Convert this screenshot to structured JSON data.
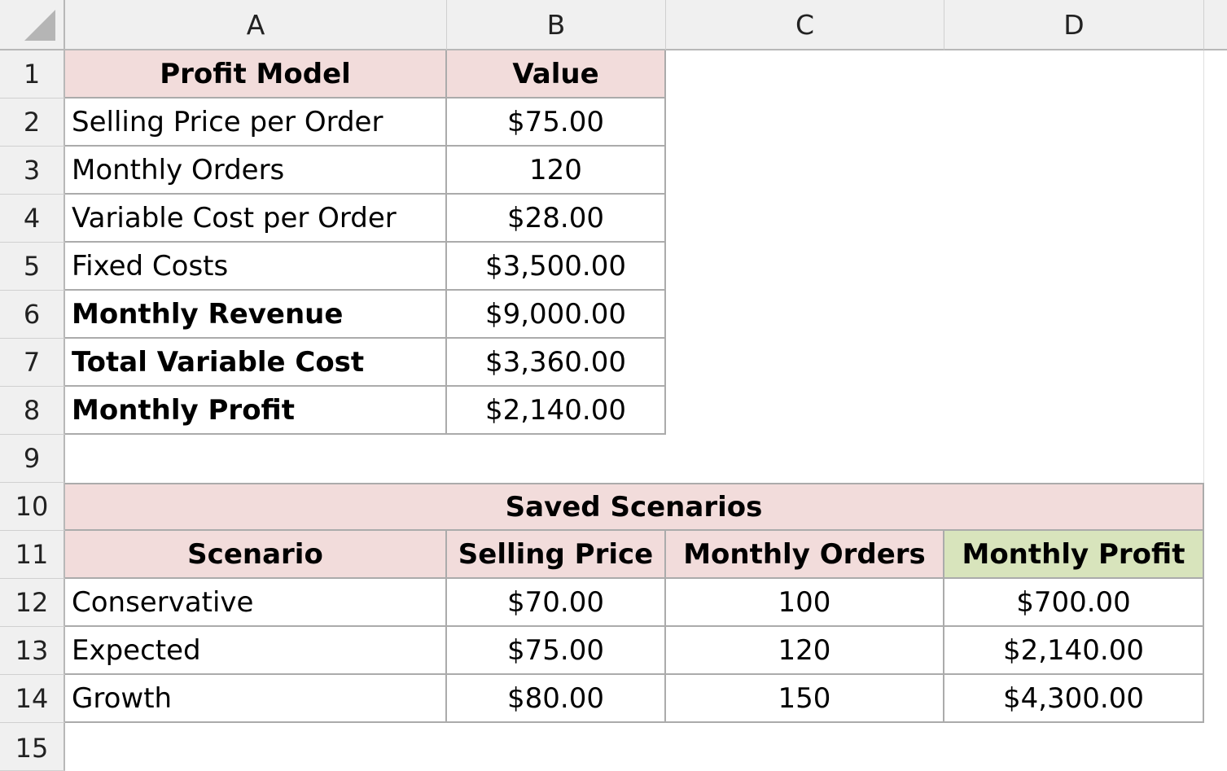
{
  "columns": [
    "A",
    "B",
    "C",
    "D"
  ],
  "rows": [
    "1",
    "2",
    "3",
    "4",
    "5",
    "6",
    "7",
    "8",
    "9",
    "10",
    "11",
    "12",
    "13",
    "14",
    "15"
  ],
  "profit_model": {
    "header": {
      "label": "Profit Model",
      "value": "Value"
    },
    "items": [
      {
        "label": "Selling Price per Order",
        "value": "$75.00"
      },
      {
        "label": "Monthly Orders",
        "value": "120"
      },
      {
        "label": "Variable Cost per Order",
        "value": "$28.00"
      },
      {
        "label": "Fixed Costs",
        "value": "$3,500.00"
      },
      {
        "label": "Monthly Revenue",
        "value": "$9,000.00"
      },
      {
        "label": "Total Variable Cost",
        "value": "$3,360.00"
      },
      {
        "label": "Monthly Profit",
        "value": "$2,140.00"
      }
    ]
  },
  "scenarios": {
    "title": "Saved Scenarios",
    "headers": [
      "Scenario",
      "Selling Price",
      "Monthly Orders",
      "Monthly Profit"
    ],
    "rows": [
      [
        "Conservative",
        "$70.00",
        "100",
        "$700.00"
      ],
      [
        "Expected",
        "$75.00",
        "120",
        "$2,140.00"
      ],
      [
        "Growth",
        "$80.00",
        "150",
        "$4,300.00"
      ]
    ]
  },
  "colors": {
    "header_fill": "#f2dcdb",
    "highlight_fill": "#d8e4bc"
  }
}
